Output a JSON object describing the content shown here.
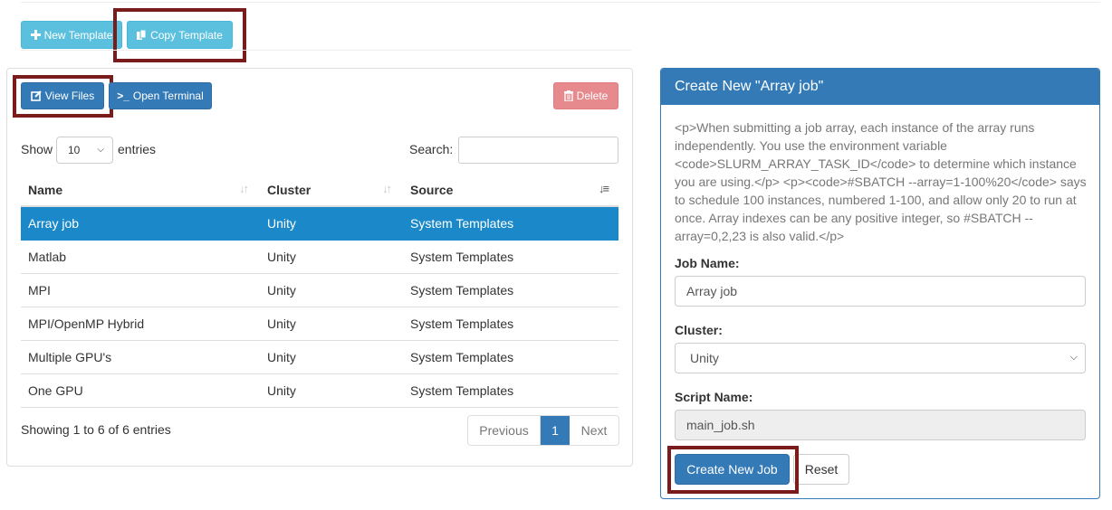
{
  "toolbar": {
    "new_template_label": "New Template",
    "copy_template_label": "Copy Template"
  },
  "list_panel": {
    "view_files_label": "View Files",
    "open_terminal_label": "Open Terminal",
    "delete_label": "Delete",
    "show_label": "Show",
    "page_length": "10",
    "entries_label": "entries",
    "search_label": "Search:",
    "search_value": "",
    "columns": [
      "Name",
      "Cluster",
      "Source"
    ],
    "rows": [
      {
        "name": "Array job",
        "cluster": "Unity",
        "source": "System Templates",
        "selected": true
      },
      {
        "name": "Matlab",
        "cluster": "Unity",
        "source": "System Templates"
      },
      {
        "name": "MPI",
        "cluster": "Unity",
        "source": "System Templates"
      },
      {
        "name": "MPI/OpenMP Hybrid",
        "cluster": "Unity",
        "source": "System Templates"
      },
      {
        "name": "Multiple GPU's",
        "cluster": "Unity",
        "source": "System Templates"
      },
      {
        "name": "One GPU",
        "cluster": "Unity",
        "source": "System Templates"
      }
    ],
    "info": "Showing 1 to 6 of 6 entries",
    "pagination": {
      "previous": "Previous",
      "current": "1",
      "next": "Next"
    }
  },
  "create_panel": {
    "title": "Create New \"Array job\"",
    "description": "<p>When submitting a job array, each instance of the array runs independently. You use the environment variable <code>SLURM_ARRAY_TASK_ID</code> to determine which instance you are using.</p> <p><code>#SBATCH --array=1-100%20</code> says to schedule 100 instances, numbered 1-100, and allow only 20 to run at once. Array indexes can be any positive integer, so #SBATCH --array=0,2,23 is also valid.</p>",
    "job_name_label": "Job Name:",
    "job_name_value": "Array job",
    "cluster_label": "Cluster:",
    "cluster_value": "Unity",
    "script_name_label": "Script Name:",
    "script_name_value": "main_job.sh",
    "create_button_label": "Create New Job",
    "reset_button_label": "Reset"
  },
  "colors": {
    "primary": "#337ab7",
    "info": "#5bc0de",
    "danger": "#e68a8d",
    "selected_row": "#1a88c9",
    "highlight_box": "#7b1c1c"
  }
}
